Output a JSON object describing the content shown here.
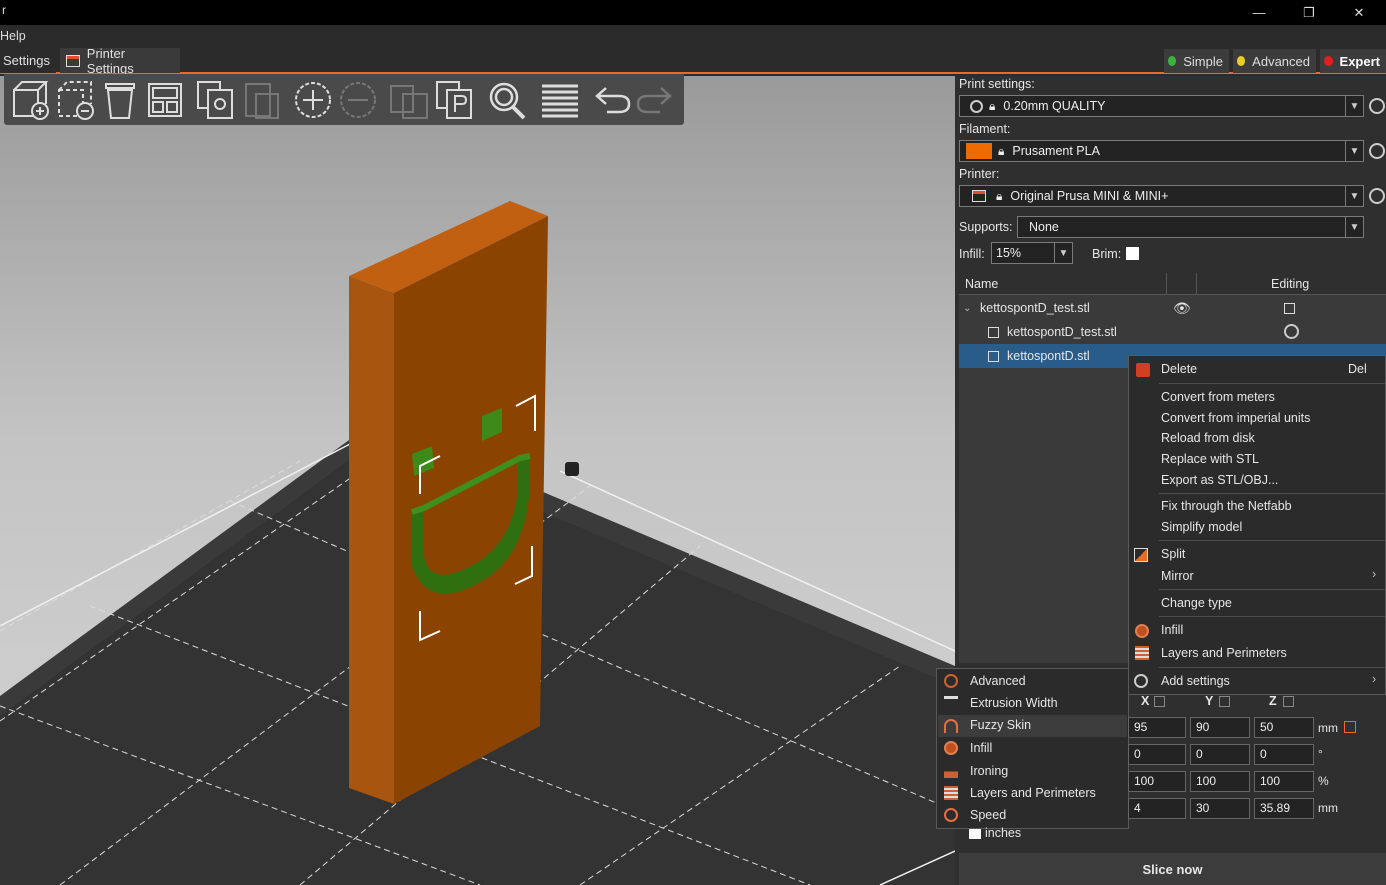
{
  "window": {
    "title": "r",
    "minimize": "—",
    "restore": "❐",
    "close": "✕"
  },
  "menu": {
    "help": "Help"
  },
  "tabs": [
    {
      "label": "Settings"
    },
    {
      "label": "Printer Settings"
    }
  ],
  "modes": [
    {
      "label": "Simple",
      "color": "#3cb43c"
    },
    {
      "label": "Advanced",
      "color": "#e8d020"
    },
    {
      "label": "Expert",
      "color": "#e02020"
    }
  ],
  "sidebar": {
    "print_settings_label": "Print settings:",
    "print_settings_value": "0.20mm QUALITY",
    "filament_label": "Filament:",
    "filament_value": "Prusament PLA",
    "filament_color": "#ed6b00",
    "printer_label": "Printer:",
    "printer_value": "Original Prusa MINI & MINI+",
    "supports_label": "Supports:",
    "supports_value": "None",
    "infill_label": "Infill:",
    "infill_value": "15%",
    "brim_label": "Brim:"
  },
  "object_list": {
    "col_name": "Name",
    "col_editing": "Editing",
    "rows": [
      {
        "name": "kettospontD_test.stl"
      },
      {
        "name": "kettospontD_test.stl"
      },
      {
        "name": "kettospontD.stl"
      }
    ]
  },
  "context_menu": {
    "delete": "Delete",
    "delete_shortcut": "Del",
    "convert_meters": "Convert from meters",
    "convert_imperial": "Convert from imperial units",
    "reload": "Reload from disk",
    "replace": "Replace with STL",
    "export": "Export as STL/OBJ...",
    "netfabb": "Fix through the Netfabb",
    "simplify": "Simplify model",
    "split": "Split",
    "mirror": "Mirror",
    "change_type": "Change type",
    "infill": "Infill",
    "layers": "Layers and Perimeters",
    "add_settings": "Add settings"
  },
  "submenu": {
    "items": [
      "Advanced",
      "Extrusion Width",
      "Fuzzy Skin",
      "Infill",
      "Ironing",
      "Layers and Perimeters",
      "Speed"
    ]
  },
  "manipulation": {
    "x": "X",
    "y": "Y",
    "z": "Z",
    "position": [
      "95",
      "90",
      "50"
    ],
    "position_unit": "mm",
    "rotation": [
      "0",
      "0",
      "0"
    ],
    "rotation_unit": "°",
    "scale": [
      "100",
      "100",
      "100"
    ],
    "scale_unit": "%",
    "size": [
      "4",
      "30",
      "35.89"
    ],
    "size_unit": "mm",
    "inches": "inches"
  },
  "slice_button": "Slice now"
}
